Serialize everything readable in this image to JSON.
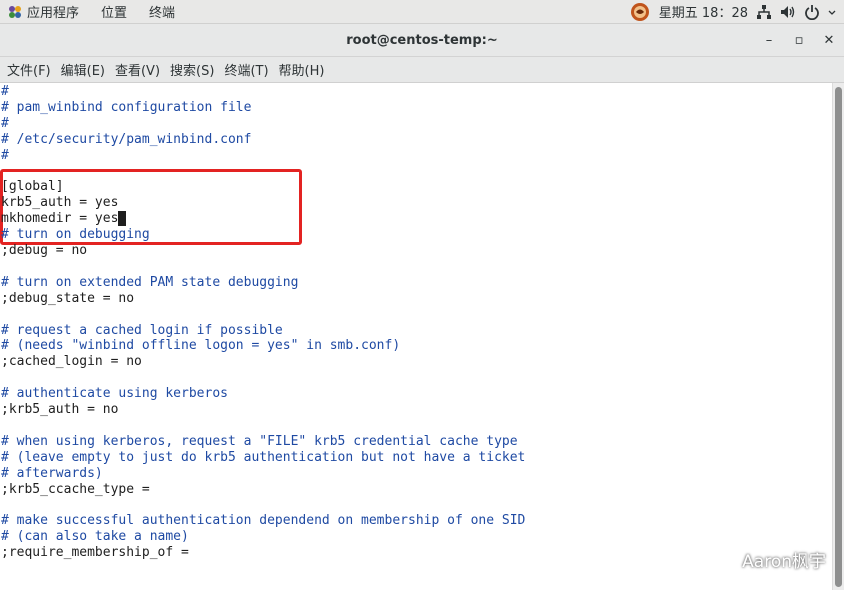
{
  "topbar": {
    "applications_label": "应用程序",
    "places_label": "位置",
    "terminal_label": "终端",
    "clock": "星期五 18：28"
  },
  "window": {
    "title": "root@centos-temp:~",
    "minimize_glyph": "–",
    "maximize_glyph": "▫",
    "close_glyph": "✕"
  },
  "menubar": {
    "items": [
      {
        "label": "文件(F)"
      },
      {
        "label": "编辑(E)"
      },
      {
        "label": "查看(V)"
      },
      {
        "label": "搜索(S)"
      },
      {
        "label": "终端(T)"
      },
      {
        "label": "帮助(H)"
      }
    ]
  },
  "terminal": {
    "lines": [
      {
        "text": "#",
        "comment": true
      },
      {
        "text": "# pam_winbind configuration file",
        "comment": true
      },
      {
        "text": "#",
        "comment": true
      },
      {
        "text": "# /etc/security/pam_winbind.conf",
        "comment": true
      },
      {
        "text": "#",
        "comment": true
      },
      {
        "text": "",
        "comment": false
      },
      {
        "text": "[global]",
        "comment": false
      },
      {
        "text": "krb5_auth = yes",
        "comment": false
      },
      {
        "text": "mkhomedir = yes",
        "comment": false,
        "cursor": true
      },
      {
        "text": "# turn on debugging",
        "comment": true
      },
      {
        "text": ";debug = no",
        "comment": false
      },
      {
        "text": "",
        "comment": false
      },
      {
        "text": "# turn on extended PAM state debugging",
        "comment": true
      },
      {
        "text": ";debug_state = no",
        "comment": false
      },
      {
        "text": "",
        "comment": false
      },
      {
        "text": "# request a cached login if possible",
        "comment": true
      },
      {
        "text": "# (needs \"winbind offline logon = yes\" in smb.conf)",
        "comment": true
      },
      {
        "text": ";cached_login = no",
        "comment": false
      },
      {
        "text": "",
        "comment": false
      },
      {
        "text": "# authenticate using kerberos",
        "comment": true
      },
      {
        "text": ";krb5_auth = no",
        "comment": false
      },
      {
        "text": "",
        "comment": false
      },
      {
        "text": "# when using kerberos, request a \"FILE\" krb5 credential cache type",
        "comment": true
      },
      {
        "text": "# (leave empty to just do krb5 authentication but not have a ticket",
        "comment": true
      },
      {
        "text": "# afterwards)",
        "comment": true
      },
      {
        "text": ";krb5_ccache_type =",
        "comment": false
      },
      {
        "text": "",
        "comment": false
      },
      {
        "text": "# make successful authentication dependend on membership of one SID",
        "comment": true
      },
      {
        "text": "# (can also take a name)",
        "comment": true
      },
      {
        "text": ";require_membership_of =",
        "comment": false
      }
    ]
  },
  "watermark": {
    "text": "Aaron枫宇"
  },
  "colors": {
    "comment": "#1f4aa3",
    "text": "#1e1e1e",
    "highlight": "#e32322"
  }
}
